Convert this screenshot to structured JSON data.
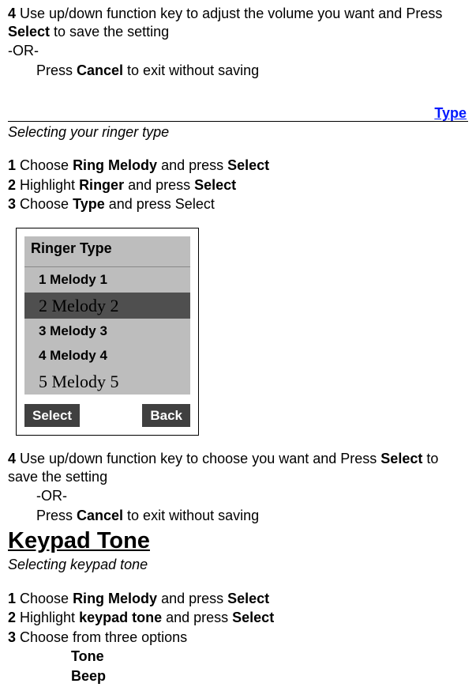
{
  "ringerVolume": {
    "step4_prefix": "4",
    "step4_text_a": " Use up/down function key to adjust the volume you want and Press ",
    "step4_bold": "Select",
    "step4_text_b": " to save the setting",
    "or": " -OR-",
    "cancel_a": "Press ",
    "cancel_bold": "Cancel",
    "cancel_b": " to exit without saving"
  },
  "typeSection": {
    "title": "Type",
    "subtitle": "Selecting your ringer type",
    "step1_num": "1",
    "step1_a": " Choose ",
    "step1_bold1": "Ring Melody",
    "step1_b": " and press ",
    "step1_bold2": "Select",
    "step2_num": "2",
    "step2_a": " Highlight ",
    "step2_bold1": "Ringer",
    "step2_b": " and press ",
    "step2_bold2": "Select",
    "step3_num": "3",
    "step3_a": " Choose ",
    "step3_bold1": "Type",
    "step3_b": " and press Select"
  },
  "phoneScreen": {
    "header": "Ringer Type",
    "items": [
      {
        "label": "1 Melody 1",
        "style": "normal"
      },
      {
        "label": "2 Melody 2",
        "style": "selected"
      },
      {
        "label": "3 Melody 3",
        "style": "normal"
      },
      {
        "label": "4 Melody 4",
        "style": "normal"
      },
      {
        "label": "5 Melody 5",
        "style": "greyish"
      }
    ],
    "softLeft": "Select",
    "softRight": "Back"
  },
  "afterScreen": {
    "step4_prefix": "4",
    "step4_text_a": " Use up/down function key to choose you want and Press ",
    "step4_bold": "Select",
    "step4_text_b": " to save the setting",
    "or": "-OR-",
    "cancel_a": "Press ",
    "cancel_bold": "Cancel",
    "cancel_b": " to exit without saving"
  },
  "keypadSection": {
    "heading": "Keypad Tone",
    "subtitle": "Selecting keypad tone",
    "step1_num": "1",
    "step1_a": " Choose ",
    "step1_bold1": "Ring Melody",
    "step1_b": " and press ",
    "step1_bold2": "Select",
    "step2_num": "2",
    "step2_a": " Highlight ",
    "step2_bold1": "keypad tone",
    "step2_b": " and press ",
    "step2_bold2": "Select",
    "step3_num": "3",
    "step3_a": " Choose from three options",
    "opt1": "Tone",
    "opt2": "Beep"
  }
}
